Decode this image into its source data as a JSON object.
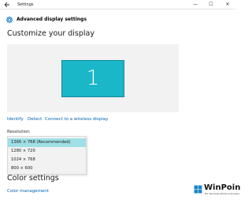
{
  "window": {
    "title": "Settings",
    "back_icon": "back-arrow-icon",
    "minimize_glyph": "—",
    "maximize_glyph": "☐",
    "close_glyph": "✕"
  },
  "header": {
    "icon": "gear-icon",
    "title": "Advanced display settings"
  },
  "customize": {
    "title": "Customize your display",
    "monitor_number": "1",
    "monitor_color": "#1ab7c8"
  },
  "links": {
    "identify": "Identify",
    "detect": "Detect",
    "wireless": "Connect to a wireless display"
  },
  "resolution": {
    "label": "Resolution",
    "options": [
      "1366 × 768 (Recommended)",
      "1280 × 720",
      "1024 × 768",
      "800 × 600"
    ],
    "selected_index": 0,
    "selected_color": "#9fdfe6"
  },
  "color_settings": {
    "title": "Color settings",
    "link": "Color management"
  },
  "watermark": {
    "brand": "WinPoin",
    "tagline": "#1 Windows Portal Indonesia"
  },
  "colors": {
    "accent": "#0063b1",
    "preview_bg": "#f2f2f2"
  }
}
